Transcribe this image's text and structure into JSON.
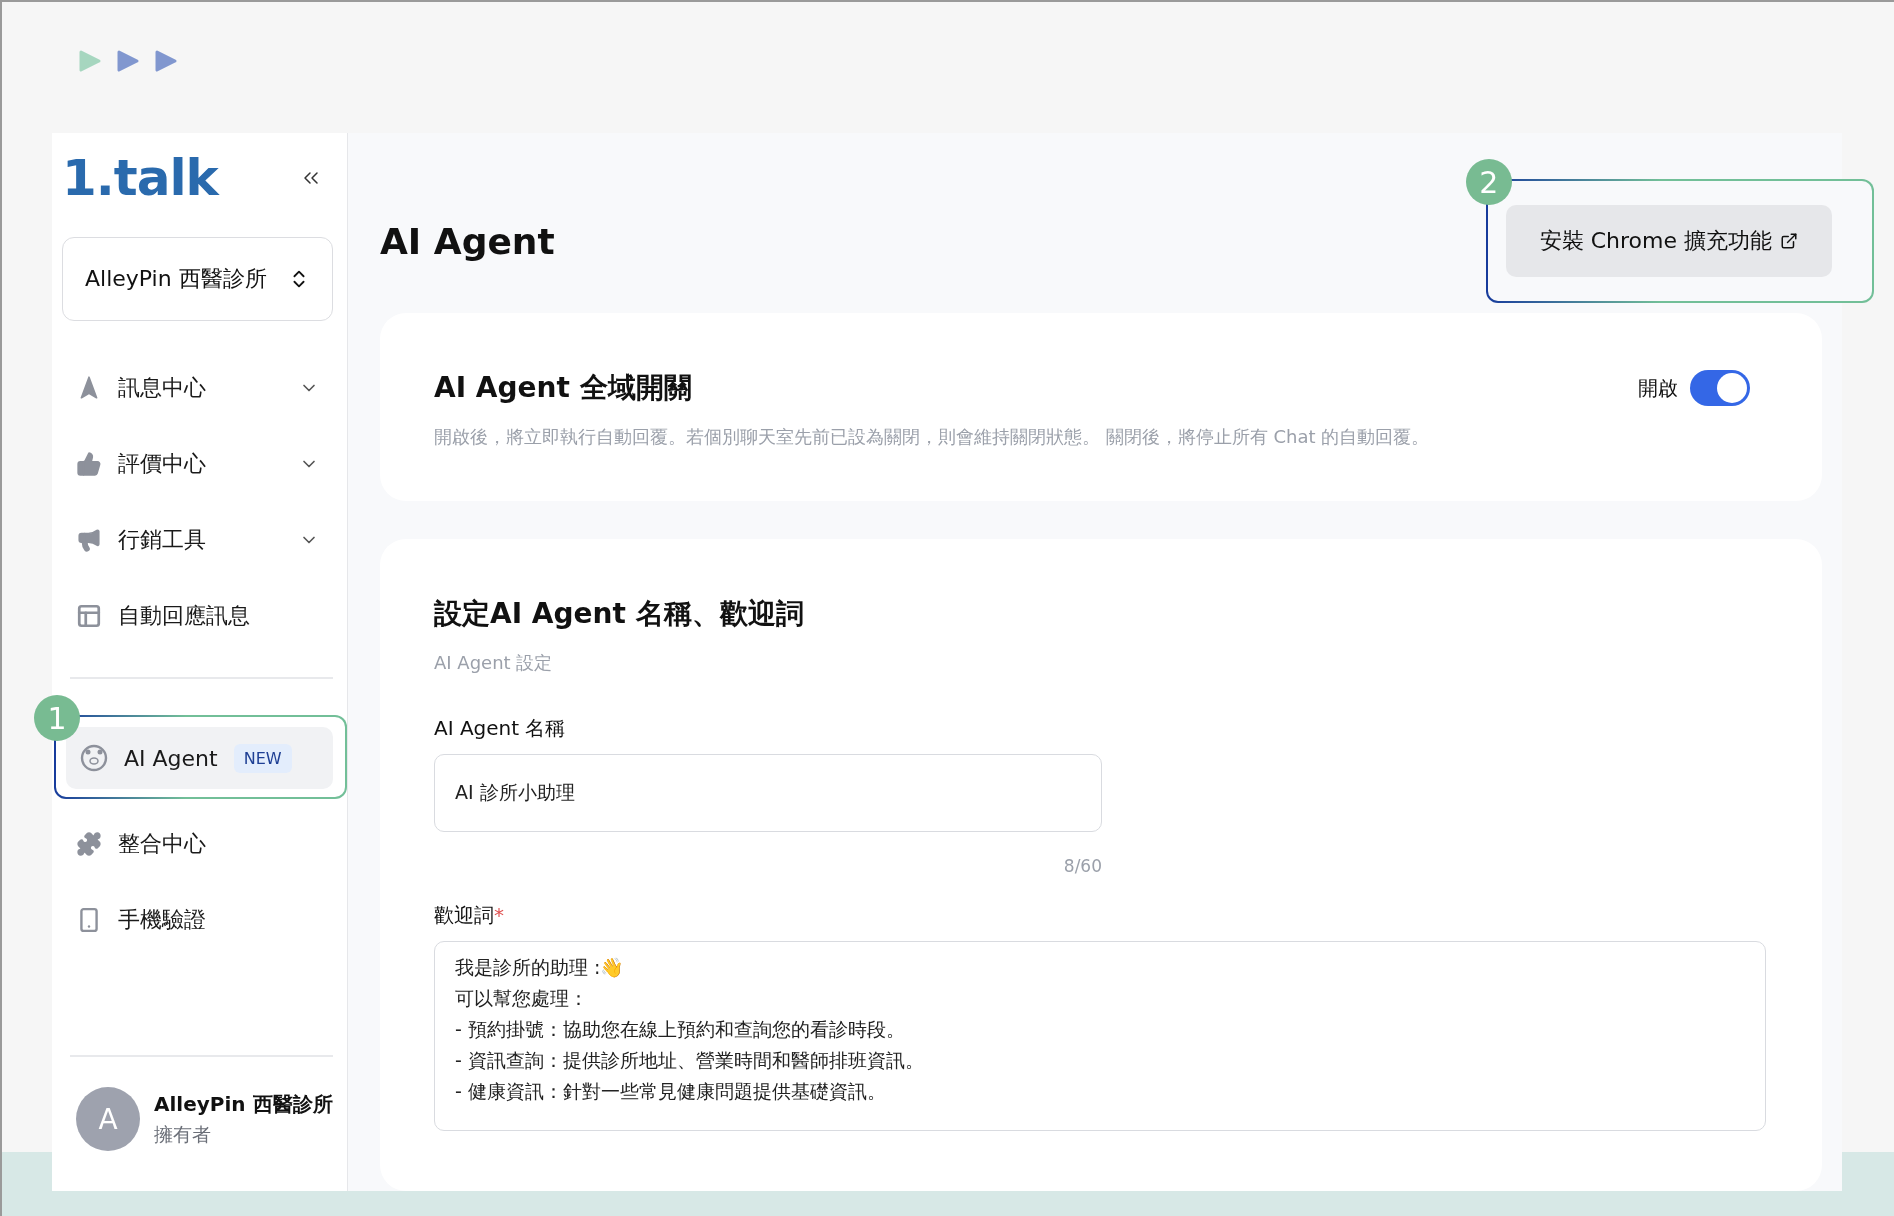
{
  "sidebar": {
    "logo": "1.talk",
    "workspace": "AlleyPin 西醫診所",
    "nav_sections": [
      [
        {
          "label": "訊息中心",
          "kind": "group",
          "selected": false
        },
        {
          "label": "評價中心",
          "kind": "group",
          "selected": false
        },
        {
          "label": "行銷工具",
          "kind": "group",
          "selected": false
        },
        {
          "label": "自動回應訊息",
          "kind": "link",
          "selected": false
        }
      ],
      [
        {
          "label": "AI Agent",
          "kind": "link",
          "badge": "NEW",
          "annotation": "1",
          "selected": true
        },
        {
          "label": "整合中心",
          "kind": "link",
          "selected": false
        },
        {
          "label": "手機驗證",
          "kind": "link",
          "selected": false
        }
      ]
    ],
    "profile": {
      "avatar": "A",
      "name": "AlleyPin 西醫診所",
      "role": "擁有者"
    }
  },
  "header": {
    "title": "AI Agent",
    "button": {
      "label": "安裝 Chrome 擴充功能",
      "annotation": "2"
    }
  },
  "global_switch": {
    "title": "AI Agent 全域開關",
    "description": "開啟後，將立即執行自動回覆。若個別聊天室先前已設為關閉，則會維持關閉狀態。 關閉後，將停止所有 Chat 的自動回覆。",
    "toggle_label": "開啟",
    "on": true
  },
  "settings": {
    "title": "設定AI Agent 名稱、歡迎詞",
    "subtitle": "AI Agent 設定",
    "name_label": "AI Agent 名稱",
    "name_value": "AI 診所小助理",
    "name_counter": "8/60",
    "greeting_label": "歡迎詞",
    "greeting_required_mark": "*",
    "greeting_lines": [
      "我是診所的助理 :👋",
      "可以幫您處理：",
      "- 預約掛號：協助您在線上預約和查詢您的看診時段。",
      "- 資訊查詢：提供診所地址、營業時間和醫師排班資訊。",
      "- 健康資訊：針對一些常見健康問題提供基礎資訊。"
    ]
  }
}
